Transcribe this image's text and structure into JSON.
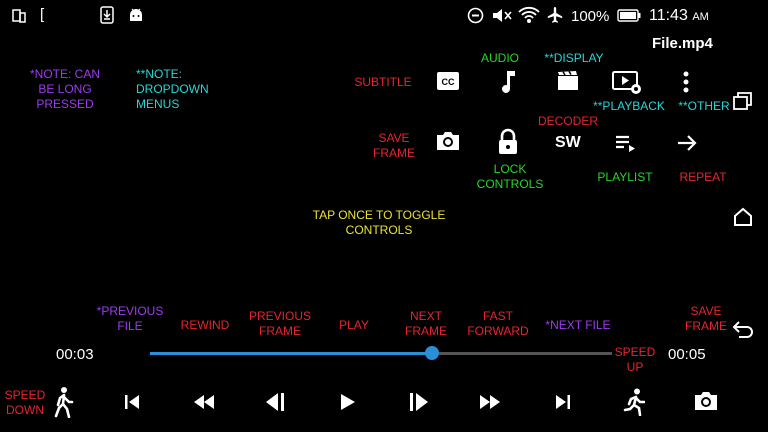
{
  "status_bar": {
    "battery": "100%",
    "time": "11:43",
    "ampm": "AM"
  },
  "file_title": "File.mp4",
  "notes": {
    "long_press": "*NOTE: CAN\nBE LONG\nPRESSED",
    "dropdown": "**NOTE:\nDROPDOWN\nMENUS"
  },
  "top_labels": {
    "subtitle": "SUBTITLE",
    "audio": "AUDIO",
    "display": "**DISPLAY",
    "playback": "**PLAYBACK",
    "other": "**OTHER",
    "decoder": "DECODER",
    "save_frame": "SAVE\nFRAME",
    "lock_controls": "LOCK\nCONTROLS",
    "playlist": "PLAYLIST",
    "repeat": "REPEAT"
  },
  "decoder_value": "SW",
  "center_hint": "TAP ONCE TO TOGGLE\nCONTROLS",
  "bottom_labels": {
    "previous_file": "*PREVIOUS\nFILE",
    "rewind": "REWIND",
    "previous_frame": "PREVIOUS\nFRAME",
    "play": "PLAY",
    "next_frame": "NEXT\nFRAME",
    "fast_forward": "FAST\nFORWARD",
    "next_file": "*NEXT FILE",
    "save_frame": "SAVE\nFRAME",
    "speed_up": "SPEED\nUP",
    "speed_down": "SPEED\nDOWN"
  },
  "seek": {
    "current_time": "00:03",
    "total_time": "00:05",
    "progress_percent": 61
  },
  "colors": {
    "accent": "#2a8fd6",
    "red_label": "#e4262b",
    "green_label": "#27d627",
    "cyan_label": "#28d6d6",
    "purple_label": "#9c3bf0",
    "yellow_label": "#ece232"
  }
}
